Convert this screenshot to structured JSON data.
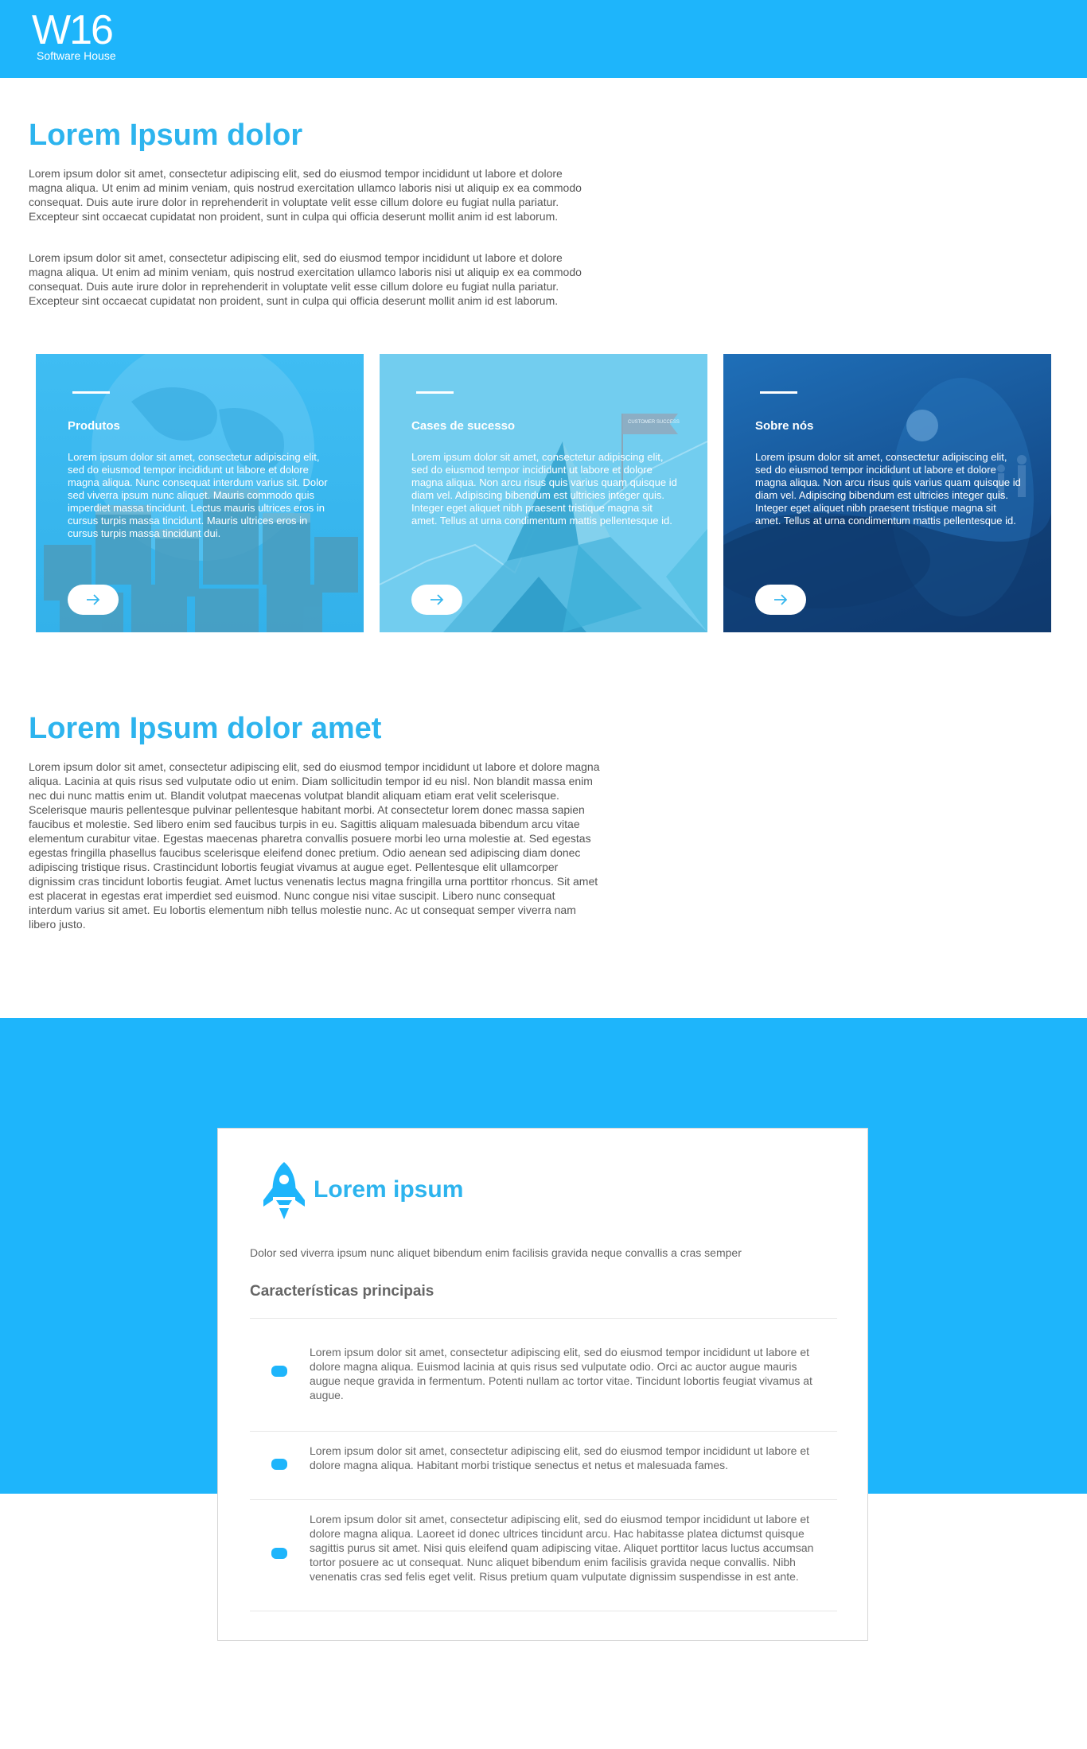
{
  "header": {
    "logo_mark": "W16",
    "logo_sub": "Software House"
  },
  "intro": {
    "title": "Lorem Ipsum dolor",
    "paragraphs": [
      "Lorem ipsum dolor sit amet, consectetur adipiscing elit, sed do eiusmod tempor incididunt ut labore et dolore magna aliqua. Ut enim ad minim veniam, quis nostrud exercitation ullamco laboris nisi ut aliquip ex ea commodo consequat. Duis aute irure dolor in reprehenderit in voluptate velit esse cillum dolore eu fugiat nulla pariatur. Excepteur sint occaecat cupidatat non proident, sunt in culpa qui officia deserunt mollit anim id est laborum.",
      "Lorem ipsum dolor sit amet, consectetur adipiscing elit, sed do eiusmod tempor incididunt ut labore et dolore magna aliqua. Ut enim ad minim veniam, quis nostrud exercitation ullamco laboris nisi ut aliquip ex ea commodo consequat. Duis aute irure dolor in reprehenderit in voluptate velit esse cillum dolore eu fugiat nulla pariatur. Excepteur sint occaecat cupidatat non proident, sunt in culpa qui officia deserunt mollit anim id est laborum."
    ]
  },
  "cards": [
    {
      "title": "Produtos",
      "text": "Lorem ipsum dolor sit amet, consectetur adipiscing elit, sed do eiusmod tempor incididunt ut labore et dolore magna aliqua. Nunc consequat interdum varius sit. Dolor sed viverra ipsum nunc aliquet. Mauris commodo quis imperdiet massa tincidunt. Lectus mauris ultrices eros in cursus turpis massa tincidunt. Mauris ultrices eros in cursus turpis massa tincidunt dui.",
      "button_icon": "arrow-right-icon",
      "color": "#35b6ee"
    },
    {
      "title": "Cases de sucesso",
      "text": "Lorem ipsum dolor sit amet, consectetur adipiscing elit, sed do eiusmod tempor incididunt ut labore et dolore magna aliqua. Non arcu risus quis varius quam quisque id diam vel. Adipiscing bibendum est ultricies integer quis. Integer eget aliquet nibh praesent tristique magna sit amet. Tellus at urna condimentum mattis pellentesque id.",
      "flag_text": "CUSTOMER SUCCESS",
      "button_icon": "arrow-right-icon",
      "color": "#72cdef"
    },
    {
      "title": "Sobre nós",
      "text": "Lorem ipsum dolor sit amet, consectetur adipiscing elit, sed do eiusmod tempor incididunt ut labore et dolore magna aliqua. Non arcu risus quis varius quam quisque id diam vel. Adipiscing bibendum est ultricies integer quis. Integer eget aliquet nibh praesent tristique magna sit amet. Tellus at urna condimentum mattis pellentesque id.",
      "button_icon": "arrow-right-icon",
      "color": "#1a5fa8"
    }
  ],
  "section2": {
    "title": "Lorem Ipsum dolor amet",
    "paragraph": "Lorem ipsum dolor sit amet, consectetur adipiscing elit, sed do eiusmod tempor incididunt ut labore et dolore magna aliqua. Lacinia at quis risus sed vulputate odio ut enim. Diam sollicitudin tempor id eu nisl. Non blandit massa enim nec dui nunc mattis enim ut. Blandit volutpat maecenas volutpat blandit aliquam etiam erat velit scelerisque. Scelerisque mauris pellentesque pulvinar pellentesque habitant morbi. At consectetur lorem donec massa sapien faucibus et molestie. Sed libero enim sed faucibus turpis in eu. Sagittis aliquam malesuada bibendum arcu vitae elementum curabitur vitae. Egestas maecenas pharetra convallis posuere morbi leo urna molestie at. Sed egestas egestas fringilla phasellus faucibus scelerisque eleifend donec pretium. Odio aenean sed adipiscing diam donec adipiscing tristique risus. Crastincidunt lobortis feugiat vivamus at augue eget. Pellentesque elit ullamcorper dignissim cras tincidunt lobortis feugiat. Amet luctus venenatis lectus magna fringilla urna porttitor rhoncus. Sit amet est placerat in egestas erat imperdiet sed euismod. Nunc congue nisi vitae suscipit. Libero nunc consequat interdum varius sit amet. Eu lobortis elementum nibh tellus molestie nunc. Ac ut consequat semper viverra nam libero justo."
  },
  "panel": {
    "icon": "rocket-icon",
    "title": "Lorem ipsum",
    "subtitle": "Dolor sed viverra ipsum nunc aliquet bibendum enim facilisis gravida neque convallis a cras semper",
    "features_heading": "Características principais",
    "features": [
      "Lorem ipsum dolor sit amet, consectetur adipiscing elit, sed do eiusmod tempor incididunt ut labore et dolore magna aliqua. Euismod lacinia at quis risus sed vulputate odio. Orci ac auctor augue mauris augue neque gravida in fermentum. Potenti nullam ac tortor vitae. Tincidunt lobortis feugiat vivamus at augue.",
      "Lorem ipsum dolor sit amet, consectetur adipiscing elit, sed do eiusmod tempor incididunt ut labore et dolore magna aliqua. Habitant morbi tristique senectus et netus et malesuada fames.",
      "Lorem ipsum dolor sit amet, consectetur adipiscing elit, sed do eiusmod tempor incididunt ut labore et dolore magna aliqua. Laoreet id donec ultrices tincidunt arcu. Hac habitasse platea dictumst quisque sagittis purus sit amet. Nisi quis eleifend quam adipiscing vitae. Aliquet porttitor lacus luctus accumsan tortor posuere ac ut consequat. Nunc aliquet bibendum enim facilisis gravida neque convallis. Nibh venenatis cras sed felis eget velit. Risus pretium quam vulputate dignissim suspendisse in est ante."
    ]
  },
  "colors": {
    "brand_blue": "#1eb5fb",
    "heading_blue": "#2db4ee"
  }
}
